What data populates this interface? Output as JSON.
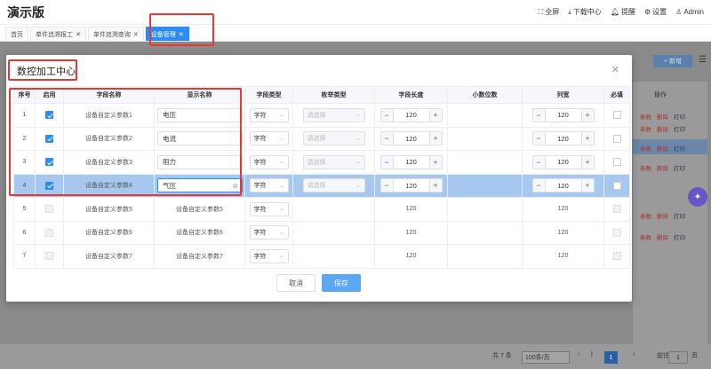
{
  "header": {
    "app_title": "演示版",
    "actions": [
      {
        "icon": "fullscreen-icon",
        "label": "全屏"
      },
      {
        "icon": "download-icon",
        "label": "下载中心"
      },
      {
        "icon": "bell-icon",
        "label": "提醒"
      },
      {
        "icon": "gear-icon",
        "label": "设置"
      },
      {
        "icon": "user-icon",
        "label": "Admin"
      }
    ]
  },
  "tabs": [
    {
      "label": "首页",
      "closable": false
    },
    {
      "label": "单件追溯报工",
      "closable": true
    },
    {
      "label": "单件追溯查询",
      "closable": true
    },
    {
      "label": "设备管理",
      "closable": true,
      "active": true
    }
  ],
  "background": {
    "add_button": "+ 新增",
    "ops_header": "操作",
    "ops": [
      "参数",
      "删除",
      "打印"
    ],
    "pagination": {
      "total": "共 7 条",
      "page_size": "100条/页",
      "current": "1",
      "goto_label": "前往",
      "goto_value": "1",
      "page_unit": "页"
    }
  },
  "modal": {
    "title": "数控加工中心",
    "close": "×",
    "columns": [
      "序号",
      "启用",
      "字段名称",
      "显示名称",
      "字段类型",
      "枚举类型",
      "字段长度",
      "小数位数",
      "列宽",
      "必填"
    ],
    "select_placeholder": "请选择",
    "rows": [
      {
        "no": "1",
        "enabled": true,
        "field_name": "设备自定义参数1",
        "display_name": "电压",
        "field_type": "字符",
        "length": "120",
        "width": "120",
        "editable": true
      },
      {
        "no": "2",
        "enabled": true,
        "field_name": "设备自定义参数2",
        "display_name": "电流",
        "field_type": "字符",
        "length": "120",
        "width": "120",
        "editable": true
      },
      {
        "no": "3",
        "enabled": true,
        "field_name": "设备自定义参数3",
        "display_name": "阻力",
        "field_type": "字符",
        "length": "120",
        "width": "120",
        "editable": true
      },
      {
        "no": "4",
        "enabled": true,
        "field_name": "设备自定义参数4",
        "display_name": "气压",
        "field_type": "字符",
        "length": "120",
        "width": "120",
        "editable": true,
        "selected": true
      },
      {
        "no": "5",
        "enabled": false,
        "field_name": "设备自定义参数5",
        "display_name": "设备自定义参数5",
        "field_type": "字符",
        "length": "120",
        "width": "120",
        "editable": false
      },
      {
        "no": "6",
        "enabled": false,
        "field_name": "设备自定义参数6",
        "display_name": "设备自定义参数6",
        "field_type": "字符",
        "length": "120",
        "width": "120",
        "editable": false
      },
      {
        "no": "7",
        "enabled": false,
        "field_name": "设备自定义参数7",
        "display_name": "设备自定义参数7",
        "field_type": "字符",
        "length": "120",
        "width": "120",
        "editable": false
      }
    ],
    "cancel_label": "取消",
    "save_label": "保存"
  },
  "colors": {
    "accent": "#2d8cf0",
    "highlight_red": "#e53935",
    "selected_row": "#a7c8ee"
  }
}
